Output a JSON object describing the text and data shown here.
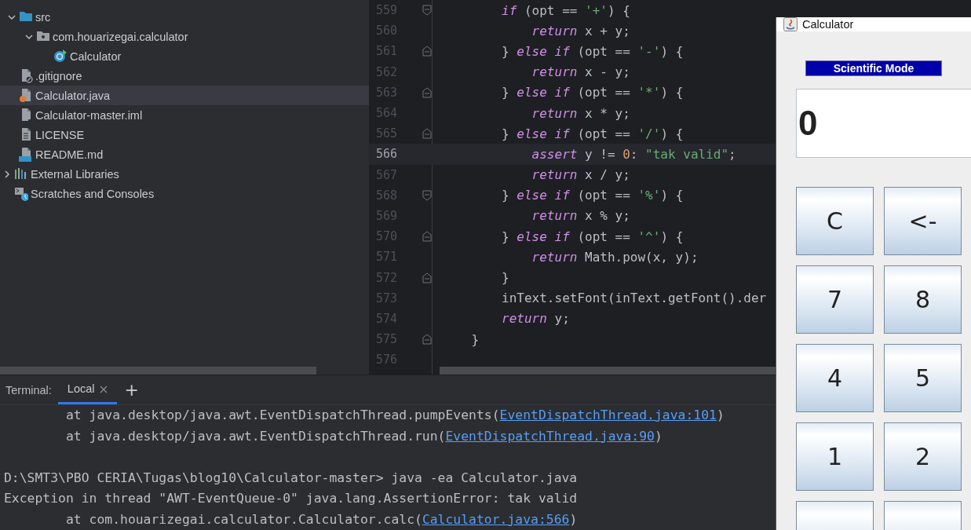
{
  "project_tree": {
    "items": [
      {
        "children": [
          {
            "label": "src",
            "kind": "folder",
            "expanded": true,
            "selected": false,
            "children": [
              {
                "label": "com.houarizegai.calculator",
                "kind": "package",
                "expanded": true,
                "selected": false,
                "children": [
                  {
                    "label": "Calculator",
                    "kind": "class",
                    "selected": false
                  }
                ]
              }
            ]
          },
          {
            "label": ".gitignore",
            "kind": "ignore",
            "selected": false
          },
          {
            "label": "Calculator.java",
            "kind": "java",
            "selected": true
          },
          {
            "label": "Calculator-master.iml",
            "kind": "module",
            "selected": false
          },
          {
            "label": "LICENSE",
            "kind": "text",
            "selected": false
          },
          {
            "label": "README.md",
            "kind": "markdown",
            "selected": false
          }
        ]
      },
      {
        "label": "External Libraries",
        "kind": "libraries",
        "expanded": false,
        "selected": false
      },
      {
        "label": "Scratches and Consoles",
        "kind": "scratches",
        "selected": false
      }
    ]
  },
  "editor": {
    "lines": [
      {
        "number": "559",
        "kind": "foldstart",
        "tokens": [
          {
            "t": "        if",
            "kind": "keyword"
          },
          {
            "t": " (opt == ",
            "kind": "plain"
          },
          {
            "t": "'+'",
            "kind": "string"
          },
          {
            "t": ") {",
            "kind": "plain"
          }
        ]
      },
      {
        "number": "560",
        "kind": "plain",
        "tokens": [
          {
            "t": "            return",
            "kind": "keyword"
          },
          {
            "t": " x + y;",
            "kind": "plain"
          }
        ]
      },
      {
        "number": "561",
        "kind": "foldend",
        "tokens": [
          {
            "t": "        } ",
            "kind": "plain"
          },
          {
            "t": "else if",
            "kind": "keyword"
          },
          {
            "t": " (opt == ",
            "kind": "plain"
          },
          {
            "t": "'-'",
            "kind": "string"
          },
          {
            "t": ") {",
            "kind": "plain"
          }
        ]
      },
      {
        "number": "562",
        "kind": "plain",
        "tokens": [
          {
            "t": "            return",
            "kind": "keyword"
          },
          {
            "t": " x - y;",
            "kind": "plain"
          }
        ]
      },
      {
        "number": "563",
        "kind": "foldend",
        "tokens": [
          {
            "t": "        } ",
            "kind": "plain"
          },
          {
            "t": "else if",
            "kind": "keyword"
          },
          {
            "t": " (opt == ",
            "kind": "plain"
          },
          {
            "t": "'*'",
            "kind": "string"
          },
          {
            "t": ") {",
            "kind": "plain"
          }
        ]
      },
      {
        "number": "564",
        "kind": "plain",
        "tokens": [
          {
            "t": "            return",
            "kind": "keyword"
          },
          {
            "t": " x * y;",
            "kind": "plain"
          }
        ]
      },
      {
        "number": "565",
        "kind": "foldend",
        "tokens": [
          {
            "t": "        } ",
            "kind": "plain"
          },
          {
            "t": "else if",
            "kind": "keyword"
          },
          {
            "t": " (opt == ",
            "kind": "plain"
          },
          {
            "t": "'/'",
            "kind": "string"
          },
          {
            "t": ") {",
            "kind": "plain"
          }
        ]
      },
      {
        "number": "566",
        "kind": "plain",
        "current": true,
        "tokens": [
          {
            "t": "            assert",
            "kind": "keyword"
          },
          {
            "t": " y != ",
            "kind": "plain"
          },
          {
            "t": "0",
            "kind": "number"
          },
          {
            "t": ": ",
            "kind": "plain"
          },
          {
            "t": "\"tak valid\"",
            "kind": "string"
          },
          {
            "t": ";",
            "kind": "plain"
          }
        ]
      },
      {
        "number": "567",
        "kind": "plain",
        "tokens": [
          {
            "t": "            return",
            "kind": "keyword"
          },
          {
            "t": " x / y;",
            "kind": "plain"
          }
        ]
      },
      {
        "number": "568",
        "kind": "foldstart",
        "tokens": [
          {
            "t": "        } ",
            "kind": "plain"
          },
          {
            "t": "else if",
            "kind": "keyword"
          },
          {
            "t": " (opt == ",
            "kind": "plain"
          },
          {
            "t": "'%'",
            "kind": "string"
          },
          {
            "t": ") {",
            "kind": "plain"
          }
        ]
      },
      {
        "number": "569",
        "kind": "plain",
        "tokens": [
          {
            "t": "            return",
            "kind": "keyword"
          },
          {
            "t": " x % y;",
            "kind": "plain"
          }
        ]
      },
      {
        "number": "570",
        "kind": "foldend",
        "tokens": [
          {
            "t": "        } ",
            "kind": "plain"
          },
          {
            "t": "else if",
            "kind": "keyword"
          },
          {
            "t": " (opt == ",
            "kind": "plain"
          },
          {
            "t": "'^'",
            "kind": "string"
          },
          {
            "t": ") {",
            "kind": "plain"
          }
        ]
      },
      {
        "number": "571",
        "kind": "plain",
        "tokens": [
          {
            "t": "            return",
            "kind": "keyword"
          },
          {
            "t": " Math.pow(x, y);",
            "kind": "plain"
          }
        ]
      },
      {
        "number": "572",
        "kind": "foldend",
        "tokens": [
          {
            "t": "        }",
            "kind": "plain"
          }
        ]
      },
      {
        "number": "573",
        "kind": "plain",
        "tokens": [
          {
            "t": "        inText.setFont(inText.getFont().der",
            "kind": "plain"
          }
        ]
      },
      {
        "number": "574",
        "kind": "plain",
        "tokens": [
          {
            "t": "        return",
            "kind": "keyword"
          },
          {
            "t": " y;",
            "kind": "plain"
          }
        ]
      },
      {
        "number": "575",
        "kind": "foldend",
        "tokens": [
          {
            "t": "    }",
            "kind": "plain"
          }
        ]
      },
      {
        "number": "576",
        "kind": "plain"
      }
    ]
  },
  "terminal": {
    "title": "Terminal:",
    "tabs": [
      {
        "label": "Local",
        "selected": true,
        "closable": true
      }
    ],
    "new_tab": "+",
    "lines": [
      {
        "segments": [
          {
            "text": "        at java.desktop/java.awt.EventDispatchThread.pumpEvents(",
            "link": false
          },
          {
            "text": "EventDispatchThread.java:101",
            "link": true
          },
          {
            "text": ")",
            "link": false
          }
        ]
      },
      {
        "segments": [
          {
            "text": "        at java.desktop/java.awt.EventDispatchThread.run(",
            "link": false
          },
          {
            "text": "EventDispatchThread.java:90",
            "link": true
          },
          {
            "text": ")",
            "link": false
          }
        ]
      },
      {
        "gap_before": true,
        "segments": [
          {
            "text": "D:\\SMT3\\PBO CERIA\\Tugas\\blog10\\Calculator-master> java -ea Calculator.java",
            "link": false
          }
        ]
      },
      {
        "segments": [
          {
            "text": "Exception in thread \"AWT-EventQueue-0\" java.lang.AssertionError: tak valid",
            "link": false
          }
        ]
      },
      {
        "segments": [
          {
            "text": "        at com.houarizegai.calculator.Calculator.calc(",
            "link": false
          },
          {
            "text": "Calculator.java:566",
            "link": true
          },
          {
            "text": ")",
            "link": false
          }
        ]
      }
    ]
  },
  "calculator": {
    "title": "Calculator",
    "mode_label": "Scientific Mode",
    "display": "0",
    "buttons": [
      {
        "label": "C"
      },
      {
        "label": "<-"
      },
      {
        "label": "7"
      },
      {
        "label": "8"
      },
      {
        "label": "4"
      },
      {
        "label": "5"
      },
      {
        "label": "1"
      },
      {
        "label": "2"
      }
    ],
    "partial_row": true
  }
}
